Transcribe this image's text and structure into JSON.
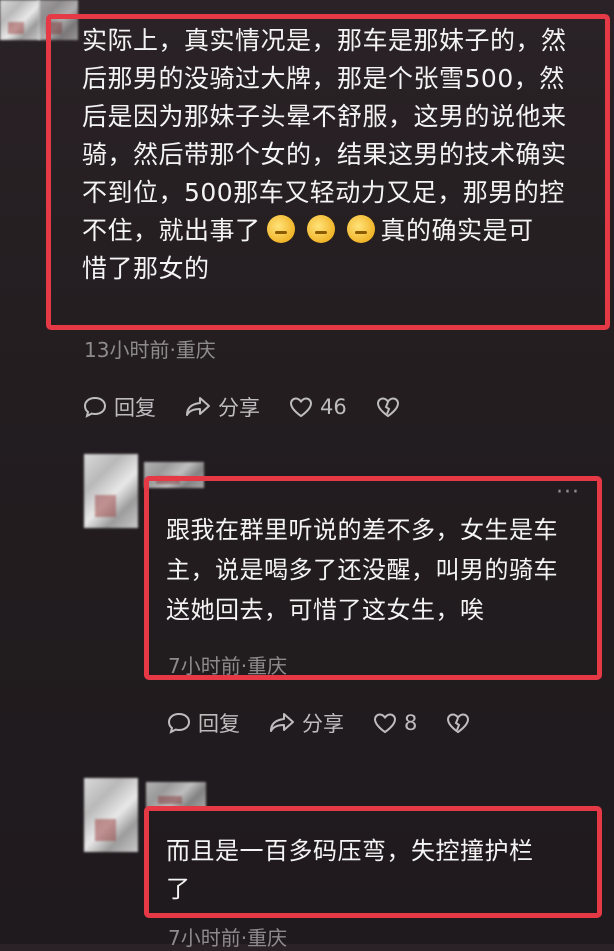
{
  "comments": [
    {
      "text_lines": [
        "实际上，真实情况是，那车是那妹子的，然",
        "后那男的没骑过大牌，那是个张雪500，然",
        "后是因为那妹子头晕不舒服，这男的说他来",
        "骑，然后带那个女的，结果这男的技术确实",
        "不到位，500那车又轻动力又足，那男的控",
        "不住，就出事了",
        "真的确实是可",
        "惜了那女的"
      ],
      "emoji_count": 3,
      "emoji_icon": "weary-face-emoji",
      "meta": "13小时前·重庆",
      "reply_label": "回复",
      "share_label": "分享",
      "like_count": "46"
    },
    {
      "text_lines": [
        "跟我在群里听说的差不多，女生是车",
        "主，说是喝多了还没醒，叫男的骑车",
        "送她回去，可惜了这女生，唉"
      ],
      "meta": "7小时前·重庆",
      "more": "···",
      "reply_label": "回复",
      "share_label": "分享",
      "like_count": "8"
    },
    {
      "text_lines": [
        "而且是一百多码压弯，失控撞护栏",
        "了"
      ],
      "meta": "7小时前·重庆"
    }
  ],
  "colors": {
    "highlight_border": "#e53945",
    "background": "#231d20",
    "meta_text": "#8e8b8d"
  }
}
